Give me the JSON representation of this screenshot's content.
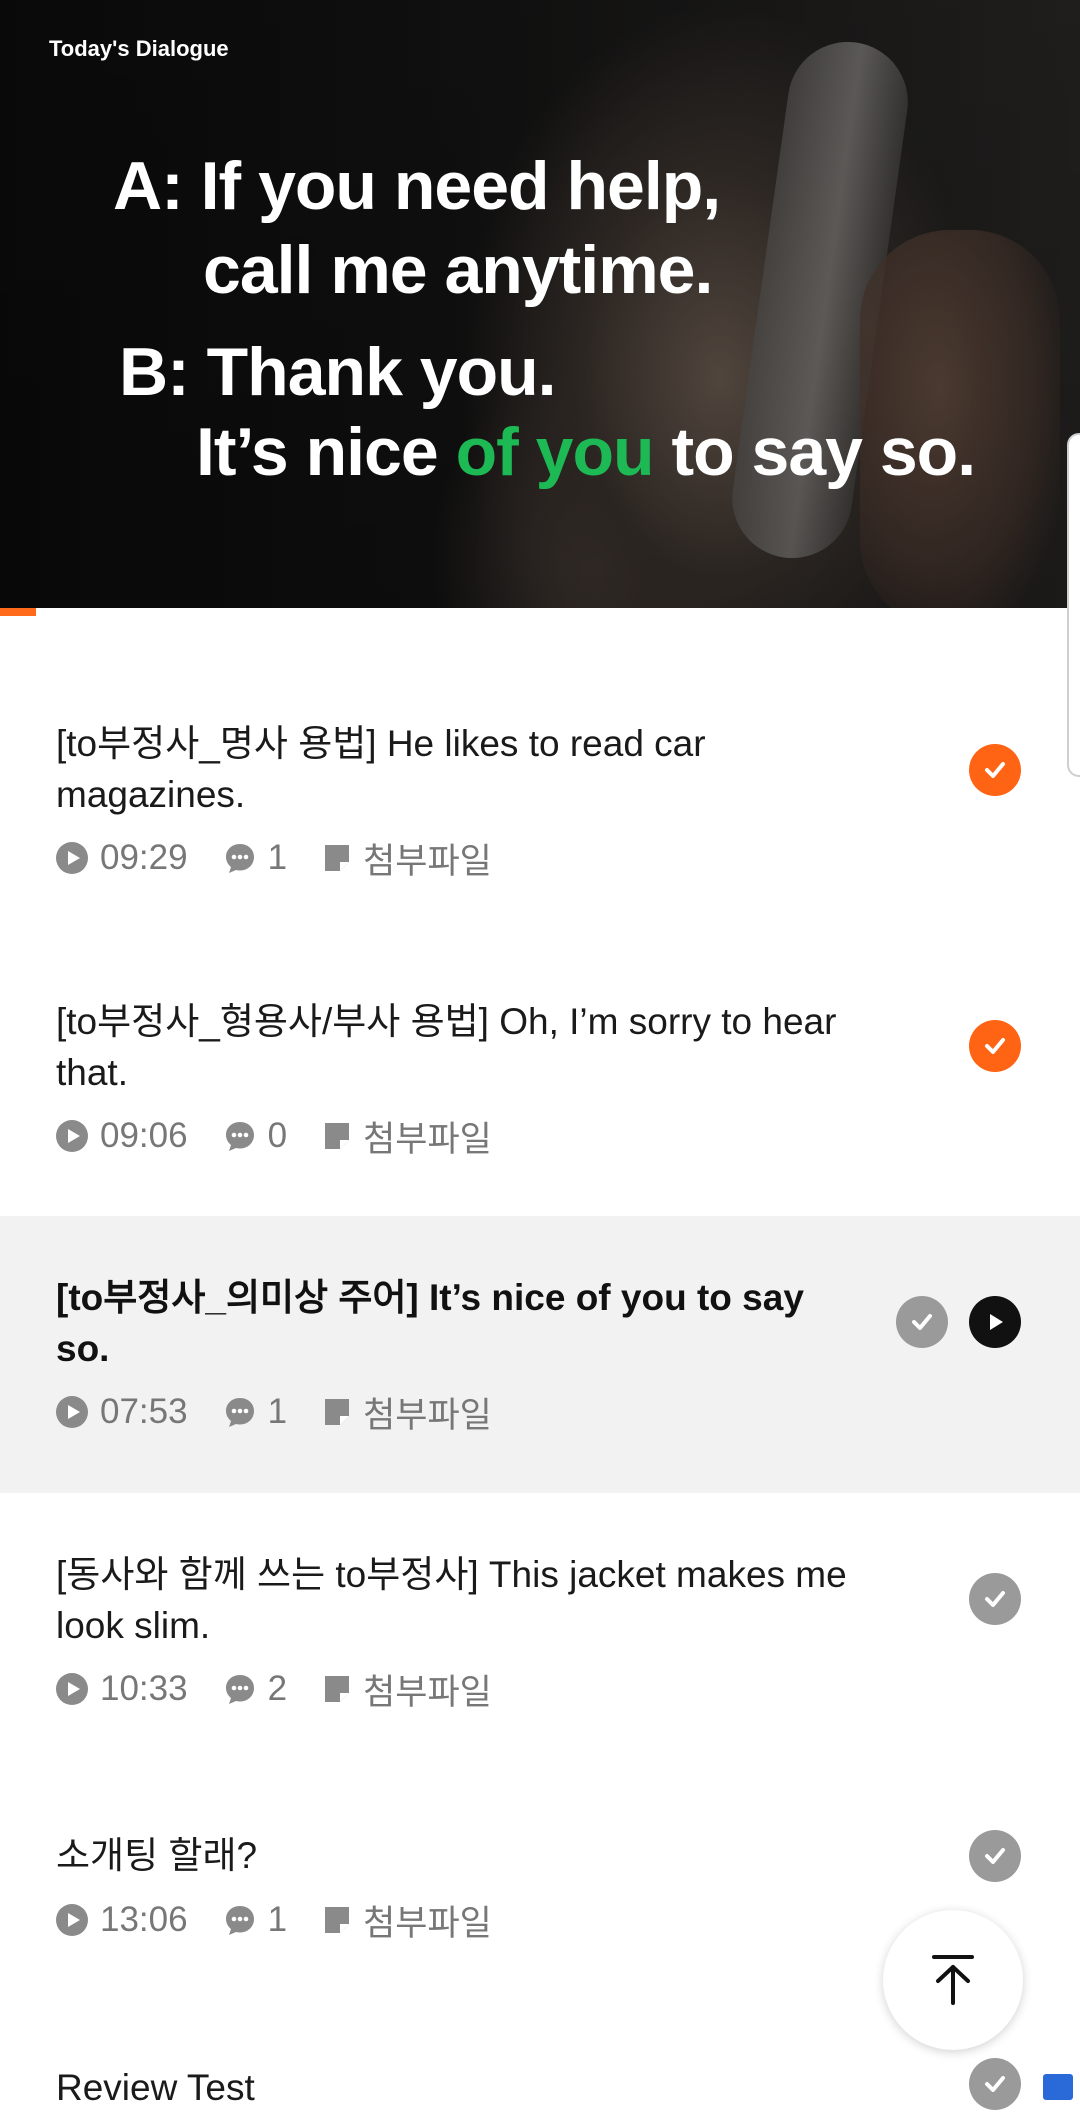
{
  "hero": {
    "label": "Today's Dialogue",
    "line_a1": "A: If you need help,",
    "line_a2": "call me anytime.",
    "line_b1": "B: Thank you.",
    "line_b2_pre": "It’s nice ",
    "line_b2_highlight": "of you",
    "line_b2_post": " to say so.",
    "highlight_color": "#1db954"
  },
  "lessons": [
    {
      "title": "[to부정사_명사 용법] He likes to read car magazines.",
      "duration": "09:29",
      "comments": "1",
      "attachment": "첨부파일",
      "status": "completed"
    },
    {
      "title": "[to부정사_형용사/부사 용법] Oh, I’m sorry to hear that.",
      "duration": "09:06",
      "comments": "0",
      "attachment": "첨부파일",
      "status": "completed"
    },
    {
      "title": "[to부정사_의미상 주어] It’s nice of you to say so.",
      "duration": "07:53",
      "comments": "1",
      "attachment": "첨부파일",
      "status": "playing"
    },
    {
      "title": "[동사와 함께 쓰는 to부정사] This jacket makes me look slim.",
      "duration": "10:33",
      "comments": "2",
      "attachment": "첨부파일",
      "status": "incomplete"
    },
    {
      "title": "소개팅 할래?",
      "duration": "13:06",
      "comments": "1",
      "attachment": "첨부파일",
      "status": "incomplete"
    },
    {
      "title": "Review Test",
      "status": "incomplete"
    }
  ],
  "icons": {
    "play": "play-circle-icon",
    "comment": "comment-bubble-icon",
    "attachment": "note-icon",
    "check": "check-circle-icon",
    "scroll_top": "arrow-up-to-top-icon"
  },
  "colors": {
    "accent": "#ff6414",
    "inactive": "#9a9a9a",
    "active_bg": "#f2f2f2"
  }
}
